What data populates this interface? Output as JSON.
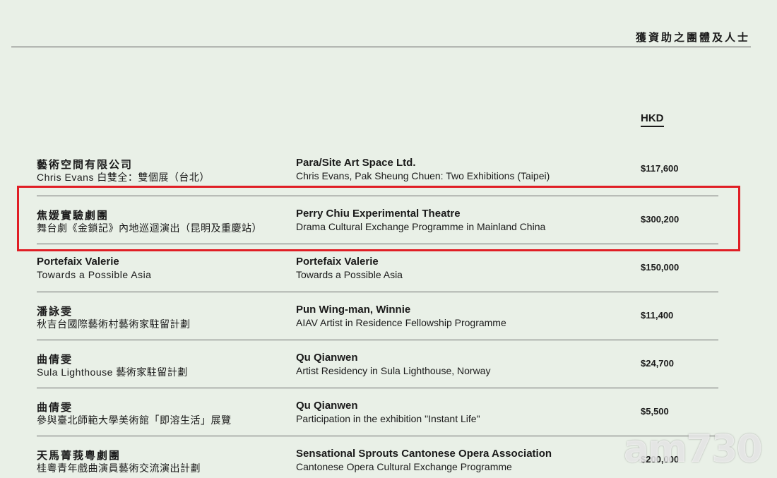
{
  "header": {
    "title": "獲資助之團體及人士"
  },
  "currency_label": "HKD",
  "rows": [
    {
      "cn_org": "藝術空間有限公司",
      "cn_project": "Chris Evans 白雙全：雙個展（台北）",
      "en_org": "Para/Site Art Space Ltd.",
      "en_project": "Chris Evans, Pak Sheung Chuen: Two Exhibitions (Taipei)",
      "amount": "$117,600"
    },
    {
      "cn_org": "焦媛實驗劇團",
      "cn_project": "舞台劇《金鎖記》內地巡迴演出（昆明及重慶站）",
      "en_org": "Perry Chiu Experimental Theatre",
      "en_project": "Drama Cultural Exchange Programme in Mainland China",
      "amount": "$300,200"
    },
    {
      "cn_org": "Portefaix Valerie",
      "cn_project": "Towards a Possible Asia",
      "en_org": "Portefaix Valerie",
      "en_project": "Towards a Possible Asia",
      "amount": "$150,000"
    },
    {
      "cn_org": "潘詠雯",
      "cn_project": "秋吉台國際藝術村藝術家駐留計劃",
      "en_org": "Pun Wing-man, Winnie",
      "en_project": "AIAV Artist in Residence Fellowship Programme",
      "amount": "$11,400"
    },
    {
      "cn_org": "曲倩雯",
      "cn_project": "Sula Lighthouse 藝術家駐留計劃",
      "en_org": "Qu Qianwen",
      "en_project": "Artist Residency in Sula Lighthouse, Norway",
      "amount": "$24,700"
    },
    {
      "cn_org": "曲倩雯",
      "cn_project": "參與臺北師範大學美術館「即溶生活」展覽",
      "en_org": "Qu Qianwen",
      "en_project": "Participation in the exhibition \"Instant Life\"",
      "amount": "$5,500"
    },
    {
      "cn_org": "天馬菁莪粵劇團",
      "cn_project": "桂粵青年戲曲演員藝術交流演出計劃",
      "en_org": "Sensational Sprouts Cantonese Opera Association",
      "en_project": "Cantonese Opera Cultural Exchange Programme",
      "amount": "$200,000"
    }
  ],
  "watermark": {
    "text": "am730"
  },
  "colors": {
    "background": "#e9f0e7",
    "highlight": "#e01e25",
    "rule": "#6b6b6b"
  }
}
